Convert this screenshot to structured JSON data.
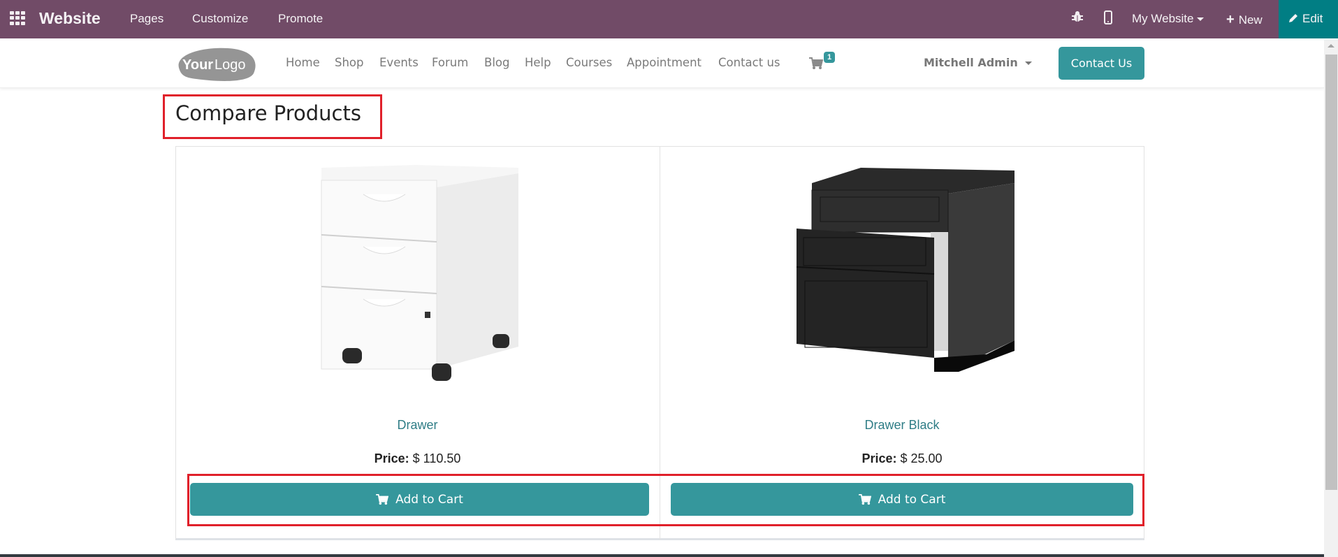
{
  "topbar": {
    "app_name": "Website",
    "menus": [
      "Pages",
      "Customize",
      "Promote"
    ],
    "site_selector": "My Website",
    "new_label": "New",
    "edit_label": "Edit",
    "icons": {
      "apps": "grid-icon",
      "debug": "bug-icon",
      "mobile": "mobile-icon",
      "new": "plus-icon",
      "edit": "pencil-icon"
    }
  },
  "navbar": {
    "logo_text": "YourLogo",
    "links": [
      "Home",
      "Shop",
      "Events",
      "Forum",
      "Blog",
      "Help",
      "Courses",
      "Appointment",
      "Contact us"
    ],
    "cart_count": "1",
    "user_name": "Mitchell Admin",
    "contact_button": "Contact Us"
  },
  "page": {
    "title": "Compare Products",
    "products": [
      {
        "name": "Drawer",
        "price_label": "Price:",
        "price": "$ 110.50",
        "button": "Add to Cart"
      },
      {
        "name": "Drawer Black",
        "price_label": "Price:",
        "price": "$ 25.00",
        "button": "Add to Cart"
      }
    ]
  },
  "colors": {
    "topbar": "#714B67",
    "edit": "#017E84",
    "accent": "#35979C",
    "link": "#2F7D86",
    "highlight": "#E0202A"
  }
}
